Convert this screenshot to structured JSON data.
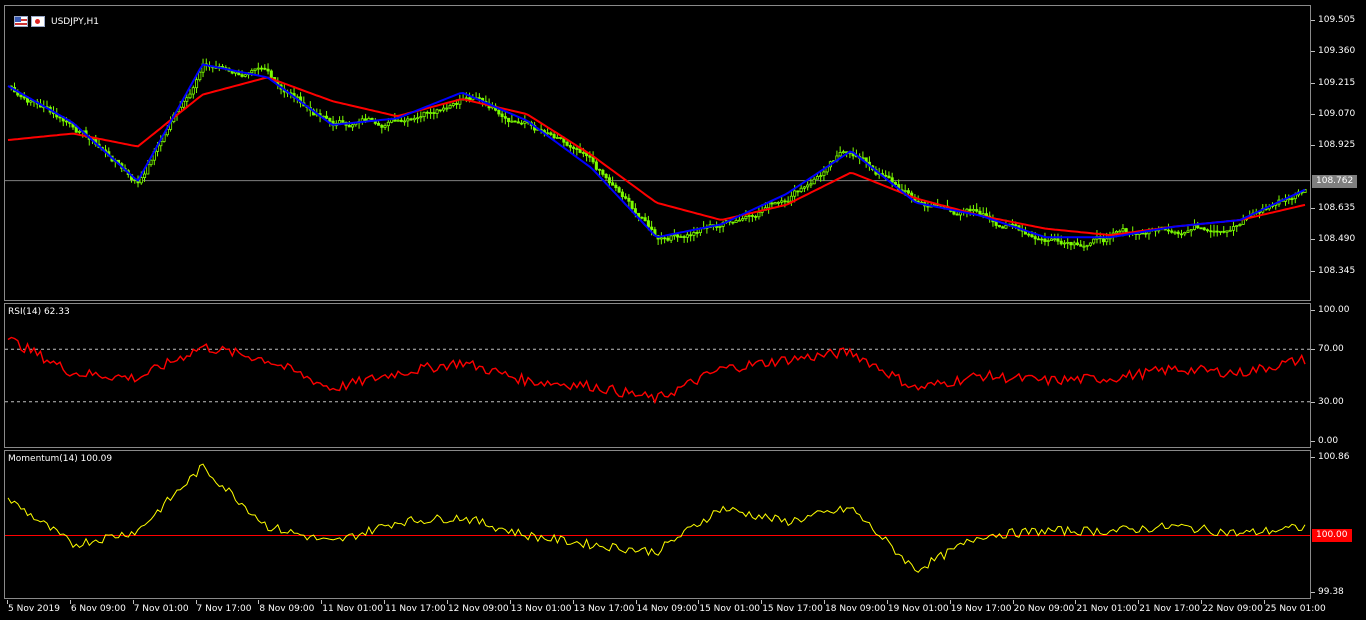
{
  "symbol": {
    "label": "USDJPY,H1"
  },
  "main": {
    "price_ticks": [
      "109.505",
      "109.360",
      "109.215",
      "109.070",
      "108.925",
      "108.635",
      "108.490",
      "108.345"
    ],
    "price_tick_values": [
      109.505,
      109.36,
      109.215,
      109.07,
      108.925,
      108.635,
      108.49,
      108.345
    ],
    "current_price": "108.762",
    "current_price_value": 108.762,
    "range": [
      108.21,
      109.57
    ]
  },
  "rsi": {
    "title": "RSI(14) 62.33",
    "ticks": [
      "100.00",
      "70.00",
      "30.00",
      "0.00"
    ],
    "tick_values": [
      100,
      70,
      30,
      0
    ],
    "levels": [
      70,
      30
    ]
  },
  "momentum": {
    "title": "Momentum(14) 100.09",
    "ticks": [
      "100.86",
      "99.38"
    ],
    "tick_values": [
      100.86,
      99.38
    ],
    "level_label": "100.00",
    "level_value": 100.0
  },
  "time_axis": [
    "5 Nov 2019",
    "6 Nov 09:00",
    "7 Nov 01:00",
    "7 Nov 17:00",
    "8 Nov 09:00",
    "11 Nov 01:00",
    "11 Nov 17:00",
    "12 Nov 09:00",
    "13 Nov 01:00",
    "13 Nov 17:00",
    "14 Nov 09:00",
    "15 Nov 01:00",
    "15 Nov 17:00",
    "18 Nov 09:00",
    "19 Nov 01:00",
    "19 Nov 17:00",
    "20 Nov 09:00",
    "21 Nov 01:00",
    "21 Nov 17:00",
    "22 Nov 09:00",
    "25 Nov 01:00"
  ],
  "colors": {
    "background": "#000000",
    "candle_bull": "#000000",
    "candle_outline": "#7CFC00",
    "ma_fast": "#0000FF",
    "ma_slow": "#FF0000",
    "rsi_line": "#FF0000",
    "momentum_line": "#FFFF00",
    "momentum_level": "#FF0000",
    "price_label_bg": "#7f7f7f",
    "level_label_bg": "#FF0000"
  },
  "chart_data": [
    {
      "type": "line",
      "title": "USDJPY,H1",
      "x": [
        "5 Nov 2019",
        "6 Nov 09:00",
        "7 Nov 01:00",
        "7 Nov 17:00",
        "8 Nov 09:00",
        "11 Nov 01:00",
        "11 Nov 17:00",
        "12 Nov 09:00",
        "13 Nov 01:00",
        "13 Nov 17:00",
        "14 Nov 09:00",
        "15 Nov 01:00",
        "15 Nov 17:00",
        "18 Nov 09:00",
        "19 Nov 01:00",
        "19 Nov 17:00",
        "20 Nov 09:00",
        "21 Nov 01:00",
        "21 Nov 17:00",
        "22 Nov 09:00",
        "25 Nov 01:00"
      ],
      "series": [
        {
          "values": [
            109.2,
            109.03,
            108.76,
            109.3,
            109.24,
            109.02,
            109.05,
            109.17,
            109.04,
            108.82,
            108.5,
            108.56,
            108.7,
            108.9,
            108.66,
            108.6,
            108.5,
            108.5,
            108.55,
            108.58,
            108.72
          ]
        },
        {
          "values": [
            108.95,
            108.98,
            108.92,
            109.16,
            109.24,
            109.13,
            109.06,
            109.14,
            109.07,
            108.88,
            108.66,
            108.58,
            108.65,
            108.8,
            108.68,
            108.6,
            108.54,
            108.51,
            108.55,
            108.58,
            108.65
          ]
        }
      ],
      "ylim": [
        108.21,
        109.57
      ]
    },
    {
      "type": "line",
      "title": "RSI(14) 62.33",
      "x": [
        "5 Nov 2019",
        "6 Nov 09:00",
        "7 Nov 01:00",
        "7 Nov 17:00",
        "8 Nov 09:00",
        "11 Nov 01:00",
        "11 Nov 17:00",
        "12 Nov 09:00",
        "13 Nov 01:00",
        "13 Nov 17:00",
        "14 Nov 09:00",
        "15 Nov 01:00",
        "15 Nov 17:00",
        "18 Nov 09:00",
        "19 Nov 01:00",
        "19 Nov 17:00",
        "20 Nov 09:00",
        "21 Nov 01:00",
        "21 Nov 17:00",
        "22 Nov 09:00",
        "25 Nov 01:00"
      ],
      "series": [
        {
          "values": [
            78,
            52,
            48,
            72,
            62,
            40,
            52,
            60,
            46,
            42,
            32,
            55,
            62,
            68,
            40,
            50,
            46,
            48,
            55,
            52,
            62.33
          ]
        }
      ],
      "ylim": [
        0,
        100
      ]
    },
    {
      "type": "line",
      "title": "Momentum(14) 100.09",
      "x": [
        "5 Nov 2019",
        "6 Nov 09:00",
        "7 Nov 01:00",
        "7 Nov 17:00",
        "8 Nov 09:00",
        "11 Nov 01:00",
        "11 Nov 17:00",
        "12 Nov 09:00",
        "13 Nov 01:00",
        "13 Nov 17:00",
        "14 Nov 09:00",
        "15 Nov 01:00",
        "15 Nov 17:00",
        "18 Nov 09:00",
        "19 Nov 01:00",
        "19 Nov 17:00",
        "20 Nov 09:00",
        "21 Nov 01:00",
        "21 Nov 17:00",
        "22 Nov 09:00",
        "25 Nov 01:00"
      ],
      "series": [
        {
          "values": [
            100.4,
            99.9,
            100.05,
            100.75,
            100.1,
            99.92,
            100.15,
            100.2,
            100.0,
            99.9,
            99.82,
            100.3,
            100.15,
            100.3,
            99.62,
            100.0,
            100.05,
            100.05,
            100.1,
            100.02,
            100.09
          ]
        }
      ],
      "ylim": [
        99.38,
        100.86
      ]
    }
  ]
}
